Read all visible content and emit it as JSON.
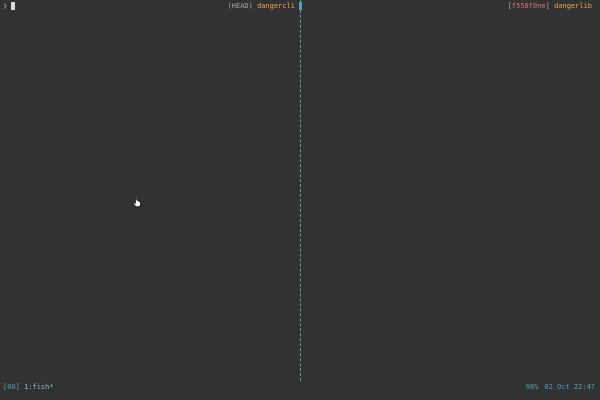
{
  "terminal": {
    "left_pane": {
      "prompt_symbol": "❯",
      "git": {
        "icon": "",
        "ref_open": "(",
        "ref": "HEAD",
        "ref_close": ")",
        "repo": "dangercli"
      }
    },
    "right_pane": {
      "git": {
        "icon": "",
        "ref_open": "[",
        "ref": "f558f0ne",
        "ref_close": "]",
        "repo": "dangerlib"
      }
    },
    "colors": {
      "background": "#323232",
      "accent": "#4fa2b8",
      "git_icon": "#d7746b",
      "repo_name": "#f0a54e"
    }
  },
  "status_bar": {
    "session": "[00]",
    "window": "1:fish*",
    "battery": "98%",
    "date": "02 Oct",
    "time": "22:47"
  }
}
